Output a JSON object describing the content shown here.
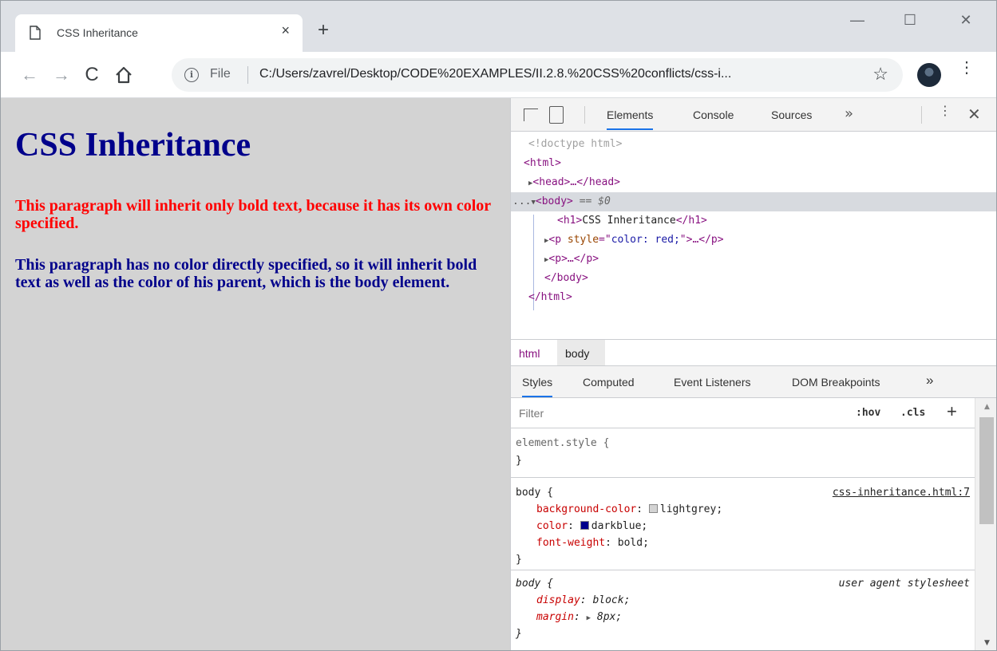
{
  "browser": {
    "tab_title": "CSS Inheritance",
    "tab_close": "×",
    "new_tab": "+",
    "window_controls": {
      "minimize": "—",
      "maximize": "☐",
      "close": "✕"
    },
    "nav": {
      "back": "←",
      "forward": "→",
      "reload": "C"
    },
    "address": {
      "info": "i",
      "scheme": "File",
      "url": "C:/Users/zavrel/Desktop/CODE%20EXAMPLES/II.2.8.%20CSS%20conflicts/css-i..."
    },
    "star": "☆",
    "menu": "⋮",
    "icons": {
      "page": "page-icon",
      "home": "home-icon",
      "avatar": "avatar-icon"
    }
  },
  "page": {
    "heading": "CSS Inheritance",
    "paragraph1": "This paragraph will inherit only bold text, because it has its own color specified.",
    "paragraph2": "This paragraph has no color directly specified, so it will inherit bold text as well as the color of his parent, which is the body element.",
    "colors": {
      "background": "lightgrey",
      "text": "darkblue",
      "red": "red"
    }
  },
  "devtools": {
    "tabs": [
      "Elements",
      "Console",
      "Sources"
    ],
    "more": "»",
    "menu": "⋮",
    "close": "✕",
    "dom": {
      "doctype": "<!doctype html>",
      "html_open": "<html>",
      "head": "<head>…</head>",
      "body_open": "<body>",
      "body_marker": "== $0",
      "h1_open": "<h1>",
      "h1_text": "CSS Inheritance",
      "h1_close": "</h1>",
      "p_red": {
        "open": "<p ",
        "attr": "style",
        "eq": "=\"",
        "value": "color: red;",
        "close": "\">…</p>"
      },
      "p_plain": "<p>…</p>",
      "body_close": "</body>",
      "html_close": "</html>",
      "ellipsis": "...",
      "arrow_expanded": "▼",
      "arrow_collapsed": "▶"
    },
    "breadcrumbs": [
      "html",
      "body"
    ],
    "sub_tabs": [
      "Styles",
      "Computed",
      "Event Listeners",
      "DOM Breakpoints"
    ],
    "sub_more": "»",
    "filter_placeholder": "Filter",
    "hov": ":hov",
    "cls": ".cls",
    "add_rule": "+",
    "rules": {
      "element_style": {
        "selector": "element.style {",
        "close": "}"
      },
      "body_author": {
        "selector": "body {",
        "source": "css-inheritance.html:7",
        "props": [
          {
            "name": "background-color",
            "value": "lightgrey",
            "swatch": "#d3d3d3"
          },
          {
            "name": "color",
            "value": "darkblue",
            "swatch": "#00008b"
          },
          {
            "name": "font-weight",
            "value": "bold"
          }
        ],
        "close": "}"
      },
      "body_ua": {
        "selector": "body {",
        "source": "user agent stylesheet",
        "props": [
          {
            "name": "display",
            "value": "block;"
          },
          {
            "name": "margin",
            "value": "8px;"
          }
        ],
        "close": "}"
      }
    },
    "scrollbar": {
      "up": "▲",
      "down": "▼"
    }
  }
}
